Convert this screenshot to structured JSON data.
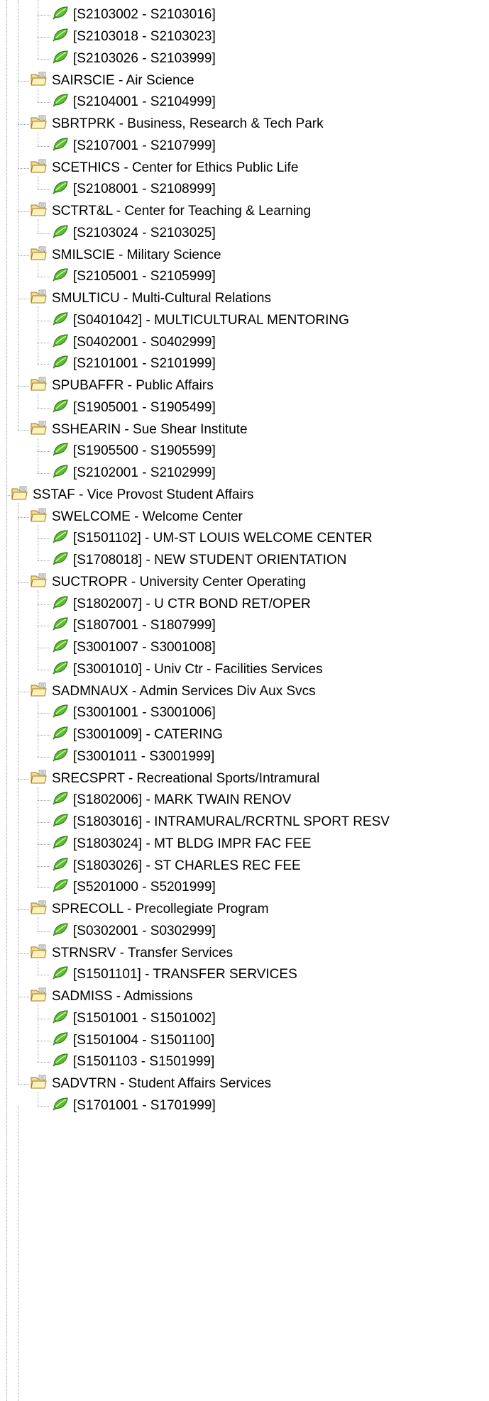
{
  "tree": {
    "nodes": [
      {
        "level": 3,
        "type": "leaf",
        "label": "[S2103002 - S2103016]"
      },
      {
        "level": 3,
        "type": "leaf",
        "label": "[S2103018 - S2103023]"
      },
      {
        "level": 3,
        "type": "leaf",
        "label": "[S2103026 - S2103999]",
        "last": true
      },
      {
        "level": 2,
        "type": "folder",
        "label": "SAIRSCIE - Air Science"
      },
      {
        "level": 3,
        "type": "leaf",
        "label": "[S2104001 - S2104999]",
        "last": true
      },
      {
        "level": 2,
        "type": "folder",
        "label": "SBRTPRK - Business, Research & Tech Park"
      },
      {
        "level": 3,
        "type": "leaf",
        "label": "[S2107001 - S2107999]",
        "last": true
      },
      {
        "level": 2,
        "type": "folder",
        "label": "SCETHICS - Center for Ethics Public Life"
      },
      {
        "level": 3,
        "type": "leaf",
        "label": "[S2108001 - S2108999]",
        "last": true
      },
      {
        "level": 2,
        "type": "folder",
        "label": "SCTRT&L - Center for Teaching & Learning"
      },
      {
        "level": 3,
        "type": "leaf",
        "label": "[S2103024 - S2103025]",
        "last": true
      },
      {
        "level": 2,
        "type": "folder",
        "label": "SMILSCIE - Military Science"
      },
      {
        "level": 3,
        "type": "leaf",
        "label": "[S2105001 - S2105999]",
        "last": true
      },
      {
        "level": 2,
        "type": "folder",
        "label": "SMULTICU - Multi-Cultural Relations"
      },
      {
        "level": 3,
        "type": "leaf",
        "label": "[S0401042] - MULTICULTURAL MENTORING"
      },
      {
        "level": 3,
        "type": "leaf",
        "label": "[S0402001 - S0402999]"
      },
      {
        "level": 3,
        "type": "leaf",
        "label": "[S2101001 - S2101999]",
        "last": true
      },
      {
        "level": 2,
        "type": "folder",
        "label": "SPUBAFFR - Public Affairs"
      },
      {
        "level": 3,
        "type": "leaf",
        "label": "[S1905001 - S1905499]",
        "last": true
      },
      {
        "level": 2,
        "type": "folder",
        "label": "SSHEARIN - Sue Shear Institute",
        "last": true
      },
      {
        "level": 3,
        "type": "leaf",
        "label": "[S1905500 - S1905599]"
      },
      {
        "level": 3,
        "type": "leaf",
        "label": "[S2102001 - S2102999]",
        "last": true
      },
      {
        "level": 1,
        "type": "folder",
        "label": "SSTAF - Vice Provost Student Affairs"
      },
      {
        "level": 2,
        "type": "folder",
        "label": "SWELCOME - Welcome Center"
      },
      {
        "level": 3,
        "type": "leaf",
        "label": "[S1501102] - UM-ST LOUIS WELCOME CENTER"
      },
      {
        "level": 3,
        "type": "leaf",
        "label": "[S1708018] - NEW STUDENT ORIENTATION",
        "last": true
      },
      {
        "level": 2,
        "type": "folder",
        "label": "SUCTROPR - University Center Operating"
      },
      {
        "level": 3,
        "type": "leaf",
        "label": "[S1802007] - U CTR BOND RET/OPER"
      },
      {
        "level": 3,
        "type": "leaf",
        "label": "[S1807001 - S1807999]"
      },
      {
        "level": 3,
        "type": "leaf",
        "label": "[S3001007 - S3001008]"
      },
      {
        "level": 3,
        "type": "leaf",
        "label": "[S3001010] - Univ Ctr - Facilities Services",
        "last": true
      },
      {
        "level": 2,
        "type": "folder",
        "label": "SADMNAUX - Admin Services Div Aux Svcs"
      },
      {
        "level": 3,
        "type": "leaf",
        "label": "[S3001001 - S3001006]"
      },
      {
        "level": 3,
        "type": "leaf",
        "label": "[S3001009] - CATERING"
      },
      {
        "level": 3,
        "type": "leaf",
        "label": "[S3001011 - S3001999]",
        "last": true
      },
      {
        "level": 2,
        "type": "folder",
        "label": "SRECSPRT - Recreational Sports/Intramural"
      },
      {
        "level": 3,
        "type": "leaf",
        "label": "[S1802006] - MARK TWAIN RENOV"
      },
      {
        "level": 3,
        "type": "leaf",
        "label": "[S1803016] - INTRAMURAL/RCRTNL SPORT RESV"
      },
      {
        "level": 3,
        "type": "leaf",
        "label": "[S1803024] - MT BLDG IMPR FAC FEE"
      },
      {
        "level": 3,
        "type": "leaf",
        "label": "[S1803026] - ST CHARLES REC FEE"
      },
      {
        "level": 3,
        "type": "leaf",
        "label": "[S5201000 - S5201999]",
        "last": true
      },
      {
        "level": 2,
        "type": "folder",
        "label": "SPRECOLL - Precollegiate Program"
      },
      {
        "level": 3,
        "type": "leaf",
        "label": "[S0302001 - S0302999]",
        "last": true
      },
      {
        "level": 2,
        "type": "folder",
        "label": "STRNSRV - Transfer Services"
      },
      {
        "level": 3,
        "type": "leaf",
        "label": "[S1501101] - TRANSFER SERVICES",
        "last": true
      },
      {
        "level": 2,
        "type": "folder",
        "label": "SADMISS - Admissions"
      },
      {
        "level": 3,
        "type": "leaf",
        "label": "[S1501001 - S1501002]"
      },
      {
        "level": 3,
        "type": "leaf",
        "label": "[S1501004 - S1501100]"
      },
      {
        "level": 3,
        "type": "leaf",
        "label": "[S1501103 - S1501999]",
        "last": true
      },
      {
        "level": 2,
        "type": "folder",
        "label": "SADVTRN - Student Affairs Services"
      },
      {
        "level": 3,
        "type": "leaf",
        "label": "[S1701001 - S1701999]",
        "last": true
      }
    ]
  },
  "colors": {
    "connector": "#9aa3b5",
    "folder_fill": "#f4dc8a",
    "folder_stroke": "#9c7a2a",
    "leaf_fill": "#5cbf2e",
    "leaf_stroke": "#2f7a12"
  }
}
